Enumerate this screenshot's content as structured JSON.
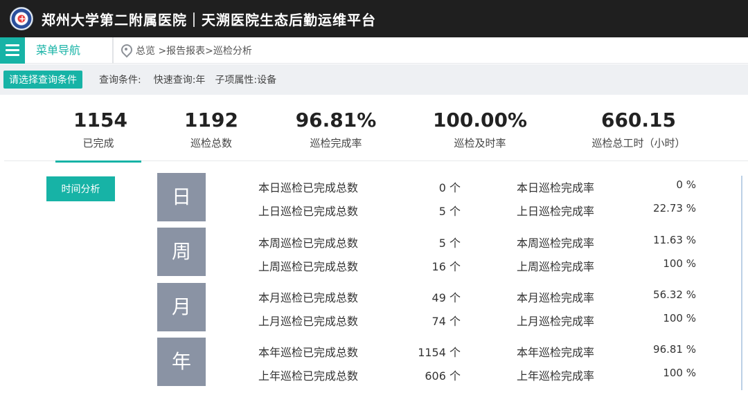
{
  "header": {
    "title": "郑州大学第二附属医院｜天溯医院生态后勤运维平台"
  },
  "nav": {
    "menu_label": "菜单导航",
    "breadcrumb": "总览 >报告报表>巡检分析"
  },
  "filter": {
    "query_button": "请选择查询条件",
    "condition_label": "查询条件:",
    "quick_query": "快速查询:年",
    "sub_attr": "子项属性:设备"
  },
  "stats": [
    {
      "value": "1154",
      "label": "已完成"
    },
    {
      "value": "1192",
      "label": "巡检总数"
    },
    {
      "value": "96.81%",
      "label": "巡检完成率"
    },
    {
      "value": "100.00%",
      "label": "巡检及时率"
    },
    {
      "value": "660.15",
      "label": "巡检总工时（小时）"
    }
  ],
  "time_analysis": {
    "button": "时间分析",
    "periods": [
      {
        "char": "日",
        "rows": [
          {
            "label": "本日巡检已完成总数",
            "count": "0 个",
            "rate_label": "本日巡检完成率",
            "rate": "0 %"
          },
          {
            "label": "上日巡检已完成总数",
            "count": "5 个",
            "rate_label": "上日巡检完成率",
            "rate": "22.73 %"
          }
        ]
      },
      {
        "char": "周",
        "rows": [
          {
            "label": "本周巡检已完成总数",
            "count": "5 个",
            "rate_label": "本周巡检完成率",
            "rate": "11.63 %"
          },
          {
            "label": "上周巡检已完成总数",
            "count": "16 个",
            "rate_label": "上周巡检完成率",
            "rate": "100 %"
          }
        ]
      },
      {
        "char": "月",
        "rows": [
          {
            "label": "本月巡检已完成总数",
            "count": "49 个",
            "rate_label": "本月巡检完成率",
            "rate": "56.32 %"
          },
          {
            "label": "上月巡检已完成总数",
            "count": "74 个",
            "rate_label": "上月巡检完成率",
            "rate": "100 %"
          }
        ]
      },
      {
        "char": "年",
        "rows": [
          {
            "label": "本年巡检已完成总数",
            "count": "1154 个",
            "rate_label": "本年巡检完成率",
            "rate": "96.81 %"
          },
          {
            "label": "上年巡检已完成总数",
            "count": "606 个",
            "rate_label": "上年巡检完成率",
            "rate": "100 %"
          }
        ]
      }
    ]
  },
  "colors": {
    "accent": "#17b3a6",
    "header_bg": "#1f1f1f",
    "period_box": "#8a93a4"
  }
}
